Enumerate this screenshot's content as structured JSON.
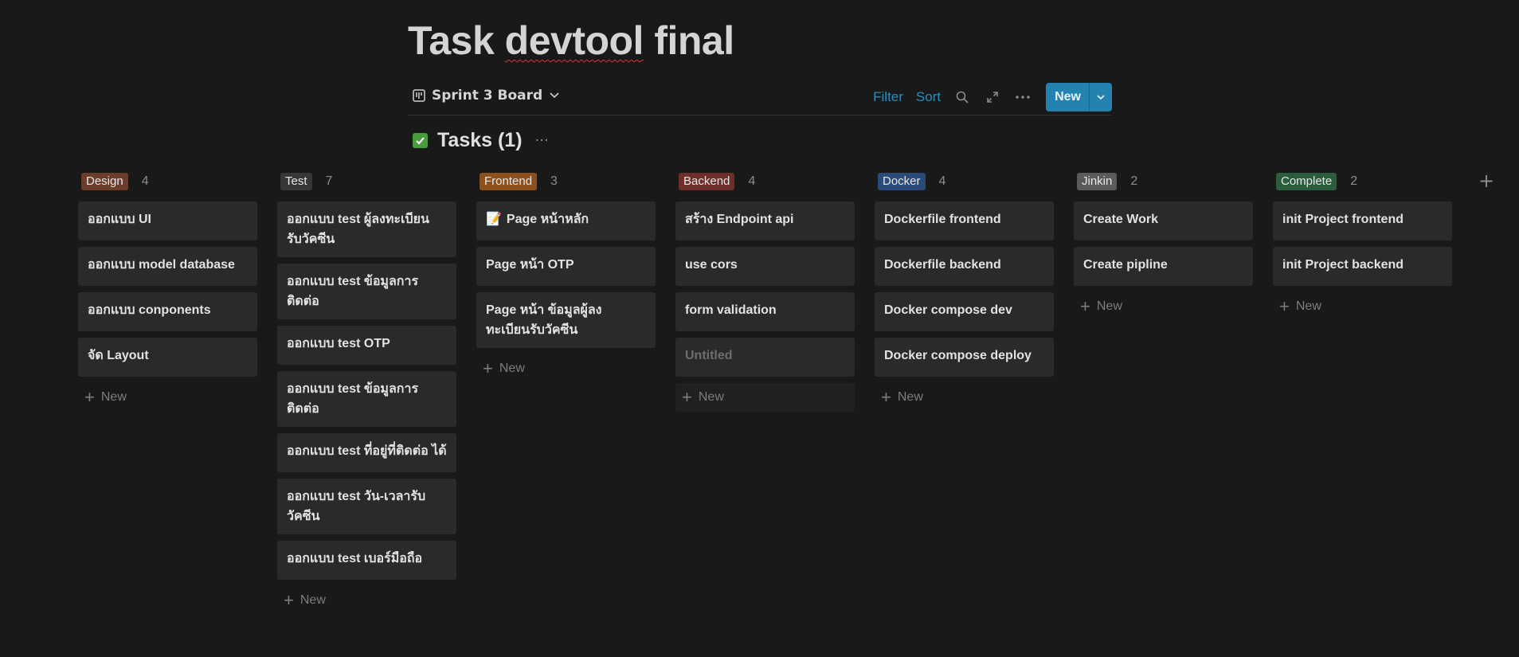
{
  "page": {
    "title_main": "Task ",
    "title_word": "devtool",
    "title_rest": " final"
  },
  "toolbar": {
    "view_name": "Sprint 3 Board",
    "filter": "Filter",
    "sort": "Sort",
    "new_label": "New"
  },
  "database": {
    "title": "Tasks (1)",
    "more": "···"
  },
  "icons": {
    "view": "board-view-icon",
    "search": "search-icon",
    "expand": "expand-icon",
    "more": "more-horizontal-icon",
    "add_column": "plus-icon"
  },
  "new_card_label": "New",
  "columns": [
    {
      "name": "Design",
      "count": "4",
      "color": "#6b3d2b",
      "cards": [
        "ออกแบบ UI",
        "ออกแบบ model database",
        "ออกแบบ conponents",
        "จัด Layout"
      ]
    },
    {
      "name": "Test",
      "count": "7",
      "color": "#373737",
      "cards": [
        "ออกแบบ test ผู้ลงทะเบียน รับวัคซีน",
        "ออกแบบ test ข้อมูลการ ติดต่อ",
        "ออกแบบ test OTP",
        "ออกแบบ test ข้อมูลการ ติดต่อ",
        "ออกแบบ test ที่อยู่ที่ติดต่อ ได้",
        "ออกแบบ test วัน-เวลารับ วัคซีน",
        "ออกแบบ test เบอร์มือถือ"
      ]
    },
    {
      "name": "Frontend",
      "count": "3",
      "color": "#8d4f1c",
      "cards": [
        "Page หน้าหลัก",
        "Page หน้า OTP",
        "Page หน้า ข้อมูลผู้ลง ทะเบียนรับวัคซีน"
      ]
    },
    {
      "name": "Backend",
      "count": "4",
      "color": "#6e2f2b",
      "cards": [
        "สร้าง Endpoint api",
        "use cors",
        "form validation",
        "Untitled"
      ]
    },
    {
      "name": "Docker",
      "count": "4",
      "color": "#2a4a78",
      "cards": [
        "Dockerfile frontend",
        "Dockerfile backend",
        "Docker compose dev",
        "Docker compose deploy"
      ]
    },
    {
      "name": "Jinkin",
      "count": "2",
      "color": "#5a5a5a",
      "cards": [
        "Create Work",
        "Create pipline"
      ]
    },
    {
      "name": "Complete",
      "count": "2",
      "color": "#2b5d3c",
      "cards": [
        "init Project frontend",
        "init Project backend"
      ]
    }
  ]
}
